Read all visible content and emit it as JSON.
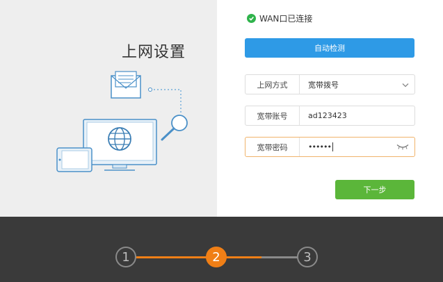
{
  "page_title": "上网设置",
  "status": {
    "text": "WAN口已连接",
    "icon": "check-circle-icon",
    "color": "#2fb34b"
  },
  "auto_detect_button": {
    "label": "自动检测",
    "color": "#2e9ae6"
  },
  "fields": {
    "connection_type": {
      "label": "上网方式",
      "value": "宽带拨号",
      "icon": "chevron-down-icon"
    },
    "account": {
      "label": "宽带账号",
      "value": "ad123423"
    },
    "password": {
      "label": "宽带密码",
      "value": "••••••",
      "icon": "eye-closed-icon"
    }
  },
  "next_button": {
    "label": "下一步",
    "color": "#5bb63a"
  },
  "steps": {
    "items": [
      "1",
      "2",
      "3"
    ],
    "current": 2,
    "active_color": "#f07f16"
  }
}
